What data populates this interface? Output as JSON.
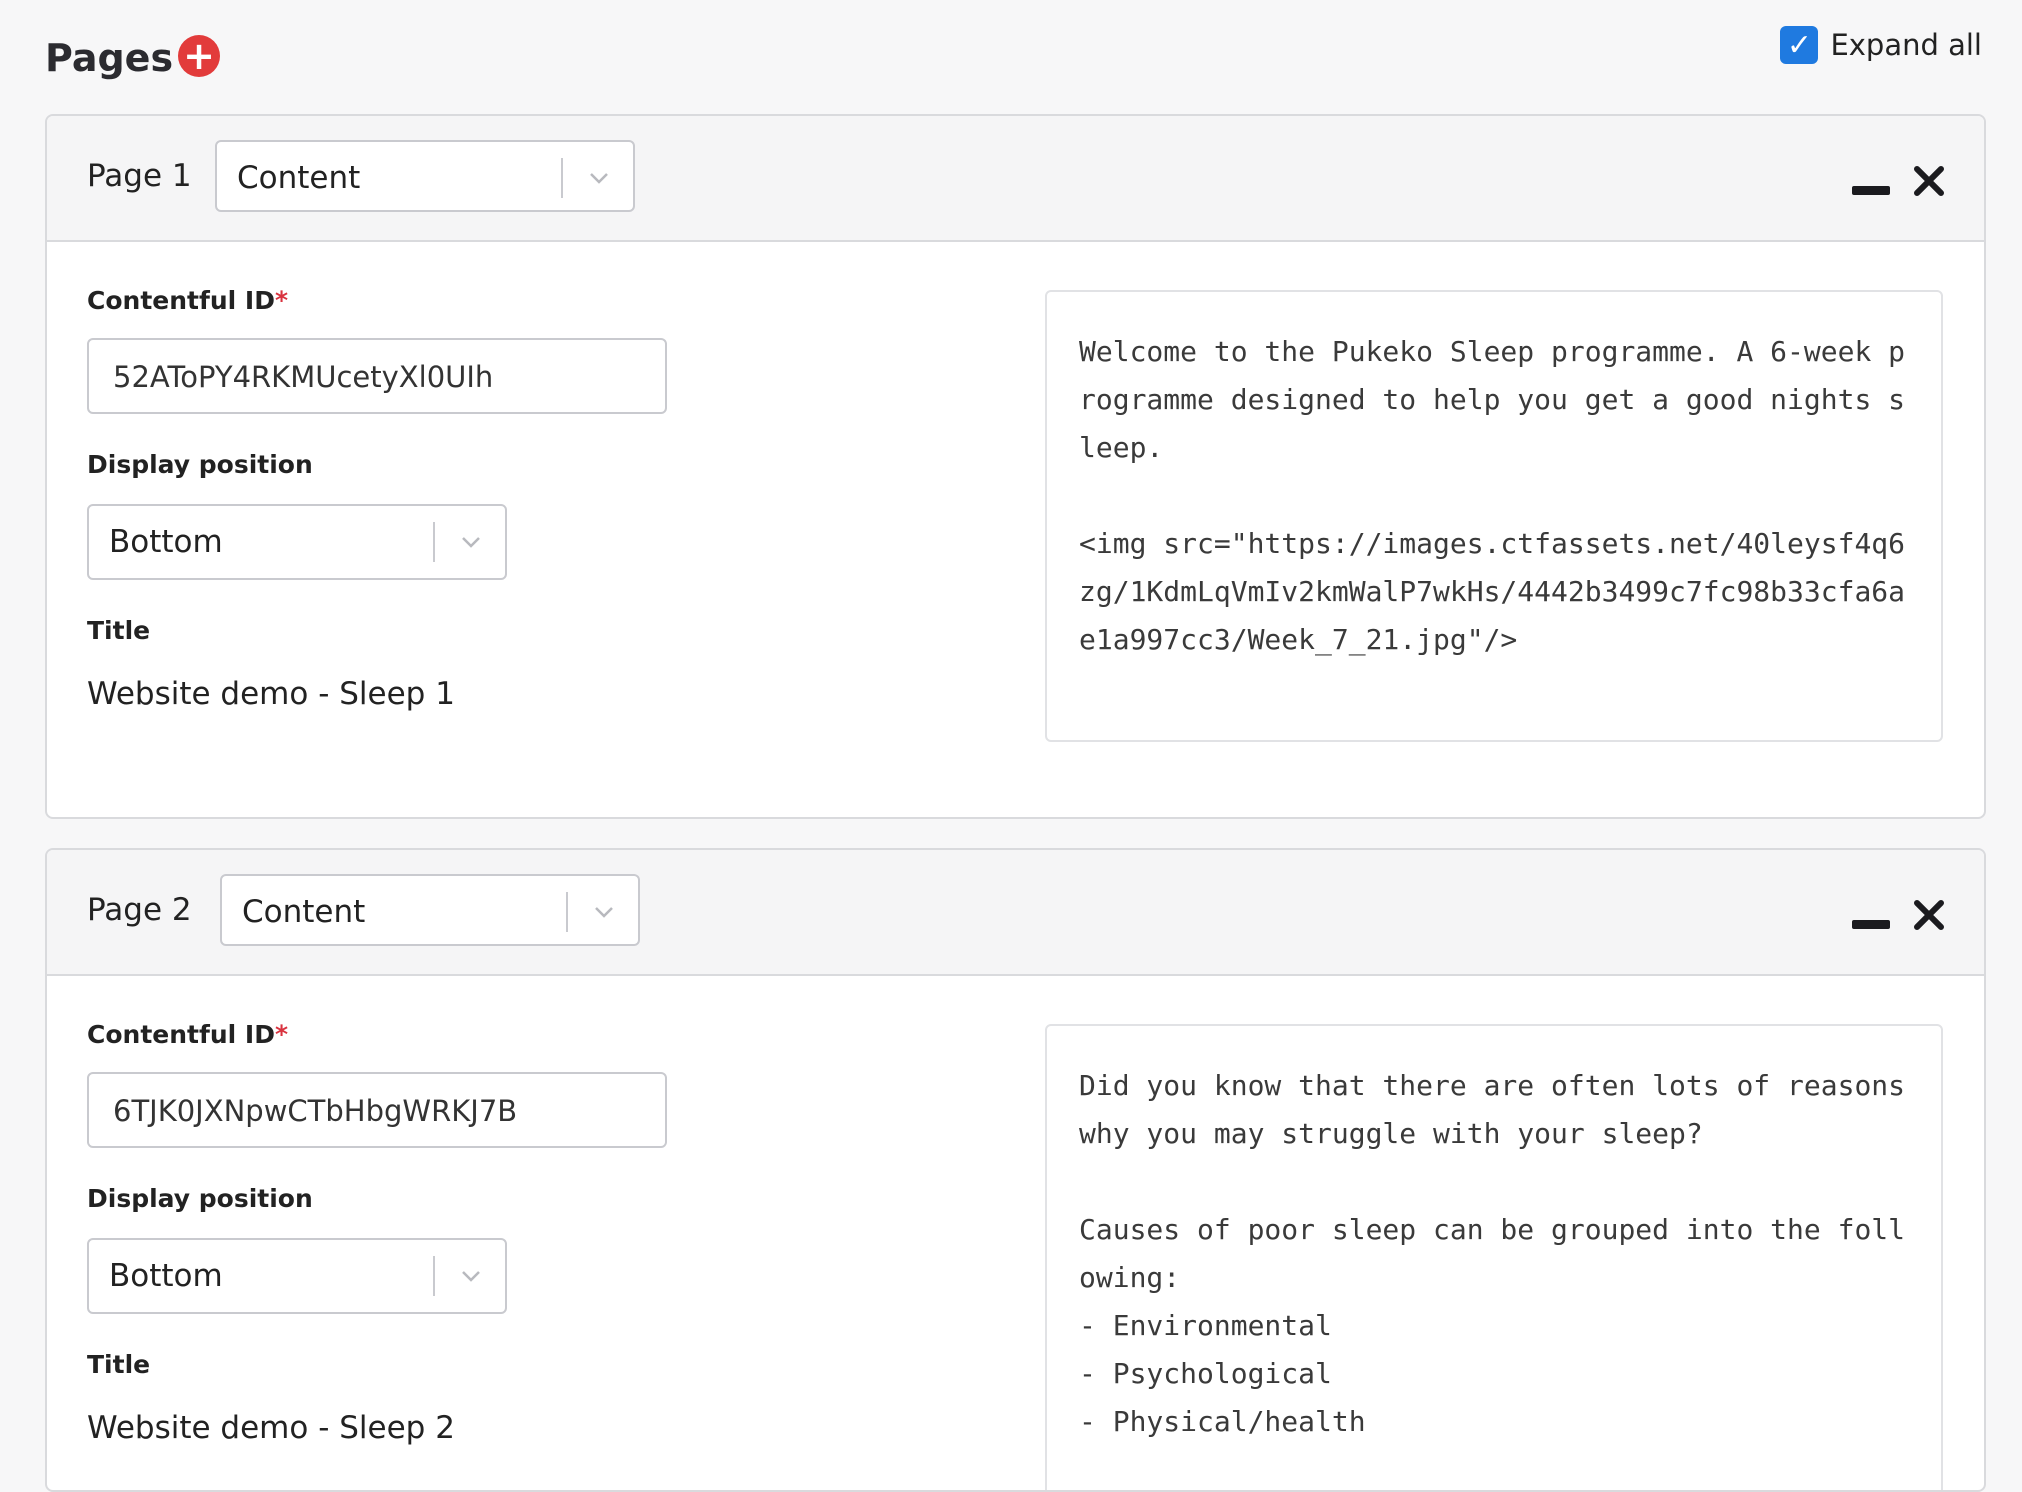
{
  "header": {
    "title": "Pages",
    "add_icon": "plus-circle-icon",
    "expand_label": "Expand all",
    "expand_checked": true,
    "accent": "#1f7ae0",
    "add_color": "#e23b3b"
  },
  "pages": [
    {
      "label": "Page 1",
      "type": "Content",
      "contentful_id_label": "Contentful ID",
      "required_mark": "*",
      "contentful_id": "52AToPY4RKMUcetyXl0UIh",
      "display_position_label": "Display position",
      "display_position": "Bottom",
      "title_label": "Title",
      "title": "Website demo - Sleep 1",
      "preview": "Welcome to the Pukeko Sleep programme. A 6-week programme designed to help you get a good nights sleep.\n\n<img src=\"https://images.ctfassets.net/40leysf4q6zg/1KdmLqVmIv2kmWalP7wkHs/4442b3499c7fc98b33cfa6ae1a997cc3/Week_7_21.jpg\"/>"
    },
    {
      "label": "Page 2",
      "type": "Content",
      "contentful_id_label": "Contentful ID",
      "required_mark": "*",
      "contentful_id": "6TJK0JXNpwCTbHbgWRKJ7B",
      "display_position_label": "Display position",
      "display_position": "Bottom",
      "title_label": "Title",
      "title": "Website demo - Sleep 2",
      "preview": "Did you know that there are often lots of reasons why you may struggle with your sleep?\n\nCauses of poor sleep can be grouped into the following:\n- Environmental\n- Psychological\n- Physical/health"
    }
  ]
}
